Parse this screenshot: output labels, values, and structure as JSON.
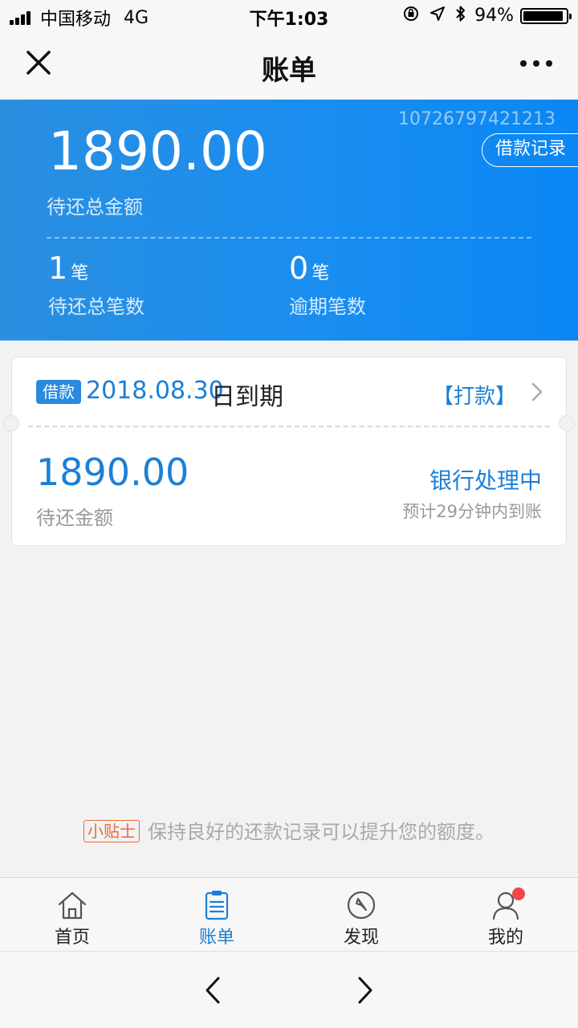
{
  "status_bar": {
    "carrier": "中国移动",
    "network": "4G",
    "time": "下午1:03",
    "battery_percent": "94%",
    "battery_level": 0.94
  },
  "nav": {
    "title": "账单",
    "close_icon": "close-icon",
    "more_icon": "more-icon"
  },
  "summary": {
    "loan_id": "10726797421213",
    "record_button": "借款记录",
    "total_amount": "1890.00",
    "total_label": "待还总金额",
    "pending_count": "1",
    "pending_unit": "笔",
    "pending_label": "待还总笔数",
    "overdue_count": "0",
    "overdue_unit": "笔",
    "overdue_label": "逾期笔数"
  },
  "bill": {
    "tag": "借款",
    "due_date": "2018.08.30",
    "due_suffix": "日到期",
    "pay_link": "【打款】",
    "amount": "1890.00",
    "amount_label": "待还金额",
    "status": "银行处理中",
    "eta": "预计29分钟内到账"
  },
  "tip": {
    "badge": "小贴士",
    "text": "保持良好的还款记录可以提升您的额度。"
  },
  "tabs": [
    {
      "label": "首页",
      "icon": "home-icon"
    },
    {
      "label": "账单",
      "icon": "bill-icon"
    },
    {
      "label": "发现",
      "icon": "compass-icon"
    },
    {
      "label": "我的",
      "icon": "user-icon"
    }
  ],
  "colors": {
    "accent": "#1c7fd6",
    "header_blue": "#1a8ef0",
    "tip_orange": "#e86a3a",
    "badge_red": "#f04848"
  }
}
